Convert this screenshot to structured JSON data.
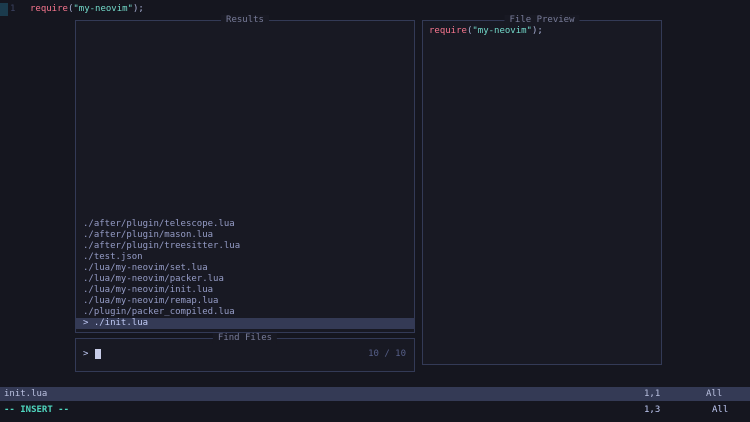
{
  "buffer": {
    "line_number": "1"
  },
  "code": {
    "keyword": "require",
    "open": "(",
    "string": "\"my-neovim\"",
    "close": ");"
  },
  "results_window": {
    "title": "Results",
    "items": [
      "./after/plugin/telescope.lua",
      "./after/plugin/mason.lua",
      "./after/plugin/treesitter.lua",
      "./test.json",
      "./lua/my-neovim/set.lua",
      "./lua/my-neovim/packer.lua",
      "./lua/my-neovim/init.lua",
      "./lua/my-neovim/remap.lua",
      "./plugin/packer_compiled.lua"
    ],
    "selected_item": "./init.lua",
    "selection_caret": "> "
  },
  "prompt_window": {
    "title": "Find Files",
    "prompt_symbol": "> ",
    "counter": "10 / 10"
  },
  "preview_window": {
    "title": "File Preview"
  },
  "statusline": {
    "filename": "init.lua",
    "position": "1,1",
    "scroll": "All"
  },
  "cmdline": {
    "mode": "-- INSERT --",
    "position": "1,3",
    "scroll": "All"
  },
  "colors": {
    "background": "#15161f",
    "float_background": "#181923",
    "border": "#333a56",
    "title": "#787c99",
    "keyword": "#f7768e",
    "string": "#73daca",
    "selection_background": "#343a55",
    "statusline_background": "#343a55",
    "mode_indicator": "#4fd6be",
    "counter": "#565f89"
  }
}
